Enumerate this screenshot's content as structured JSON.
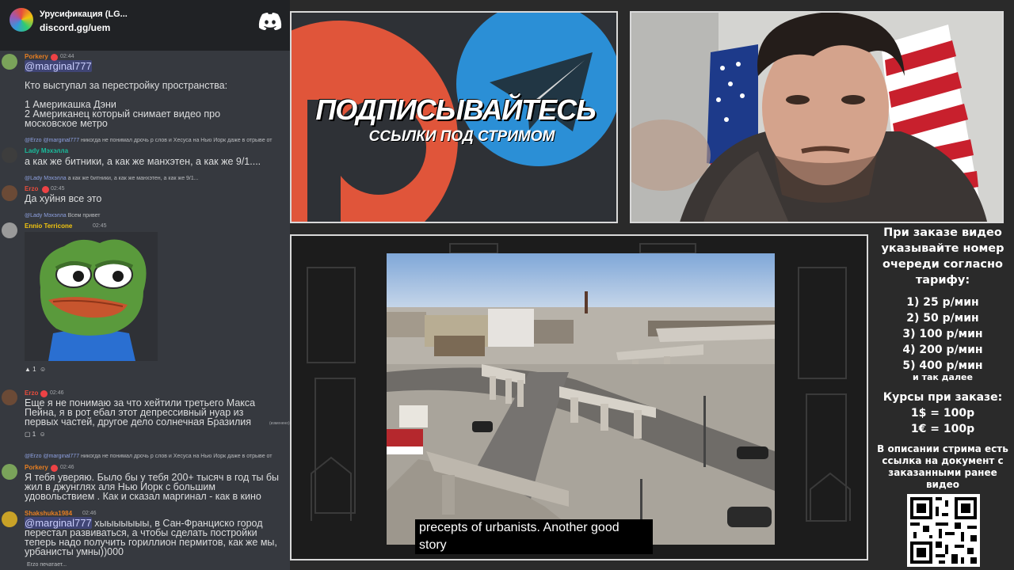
{
  "discord": {
    "server_name": "Урусификация (LG...",
    "server_link": "discord.gg/uem"
  },
  "messages": [
    {
      "user": "Porkery",
      "time": "02:44",
      "mention": "@marginal777",
      "lines": [
        "Кто выступал за перестройку пространства:",
        "",
        "1 Америкашка Дэни",
        "2 Американец который снимает видео про",
        "московское метро"
      ]
    },
    {
      "reply_user": "@Erzo",
      "reply_mention": "@marginal777",
      "reply_text": "никогда не понимал дрочь р слов и Хесуса на Нью Йорк даже в отрыве от",
      "user": "Lady Мэхэлла",
      "text": "а как же битники, а как же манхэтен, а как же 9/1...."
    },
    {
      "reply_user": "@Lady Мэхэлла",
      "reply_text": "а как же битники, а как же манхэтен, а как же 9/1...",
      "user": "Erzo",
      "time": "02:45",
      "text": "Да хуйня все это"
    },
    {
      "reply_user": "@Lady Мэхэлла",
      "reply_text": "Всем привет",
      "user": "Ennio Terricone",
      "time": "02:45",
      "reaction_count": "1"
    },
    {
      "user": "Erzo",
      "time": "02:46",
      "text": "Еще я не понимаю за что хейтили третьего Макса Пейна, я в рот ебал этот депрессивный нуар из первых частей, другое дело солнечная Бразилия",
      "edited": "(изменено)",
      "reaction_count": "1"
    },
    {
      "reply_user": "@Erzo",
      "reply_mention": "@marginal777",
      "reply_text": "никогда не понимал дрочь р слов и Хесуса на Нью Йорк даже в отрыве от",
      "user": "Porkery",
      "time": "02:46",
      "text": "Я тебя уверяю. Было бы у тебя 200+ тысяч в год ты бы жил в джунглях аля Нью Иорк с большим удовольствием . Как и сказал маргинал - как в кино"
    },
    {
      "user": "Shakshuka1984",
      "time": "02:46",
      "mention": "@marginal777",
      "text": " хыыыыыыы, в Сан-Франциско город перестал развиваться, а чтобы сделать постройки теперь надо получить гориллион пермитов, как же мы, урбанисты умны))000"
    }
  ],
  "typing": "Erzo печатает...",
  "promo": {
    "title": "ПОДПИСЫВАЙТЕСЬ",
    "subtitle": "ССЫЛКИ ПОД СТРИМОМ"
  },
  "video": {
    "subtitle_text": "precepts of urbanists. Another good story"
  },
  "info": {
    "order_text": "При заказе видео указывайте номер очереди согласно тарифу:",
    "rates": [
      "1) 25 р/мин",
      "2) 50 р/мин",
      "3) 100 р/мин",
      "4) 200 р/мин",
      "5) 400 р/мин"
    ],
    "etc": "и так далее",
    "courses_title": "Курсы при заказе:",
    "usd": "1$ = 100р",
    "eur": "1€ = 100р",
    "description": "В описании стрима есть ссылка на документ с заказанными ранее видео"
  },
  "colors": {
    "discord_bg": "#36393f",
    "discord_header": "#202225",
    "username_porkery": "#e67e22",
    "username_lady": "#1abc9c",
    "username_erzo": "#e74c3c",
    "username_ennio": "#f1c40f",
    "username_shakshuka": "#e67e22",
    "mention": "#c9cdfb",
    "telegram_blue": "#2b8fd6",
    "patreon_orange": "#e0553a"
  }
}
